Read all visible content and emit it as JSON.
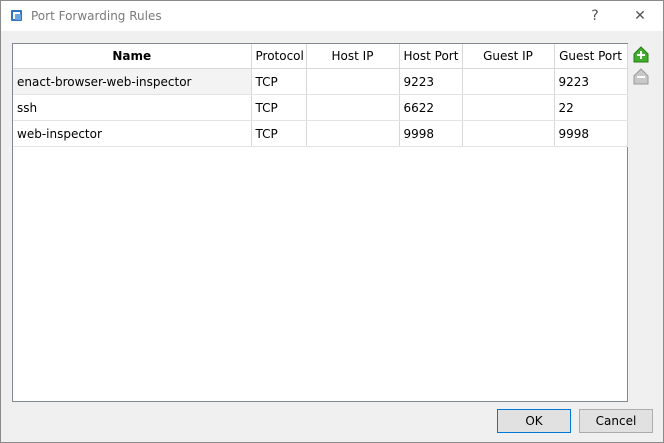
{
  "window": {
    "title": "Port Forwarding Rules",
    "help_label": "?",
    "close_label": "✕"
  },
  "table": {
    "columns": [
      "Name",
      "Protocol",
      "Host IP",
      "Host Port",
      "Guest IP",
      "Guest Port"
    ],
    "rows": [
      {
        "name": "enact-browser-web-inspector",
        "protocol": "TCP",
        "host_ip": "",
        "host_port": "9223",
        "guest_ip": "",
        "guest_port": "9223"
      },
      {
        "name": "ssh",
        "protocol": "TCP",
        "host_ip": "",
        "host_port": "6622",
        "guest_ip": "",
        "guest_port": "22"
      },
      {
        "name": "web-inspector",
        "protocol": "TCP",
        "host_ip": "",
        "host_port": "9998",
        "guest_ip": "",
        "guest_port": "9998"
      }
    ]
  },
  "side_buttons": {
    "add_icon": "add-rule-icon",
    "remove_icon": "remove-rule-icon"
  },
  "buttons": {
    "ok": "OK",
    "cancel": "Cancel"
  },
  "colors": {
    "add_green": "#3fae2a",
    "remove_gray": "#b5b5b5",
    "accent": "#0078d7"
  }
}
